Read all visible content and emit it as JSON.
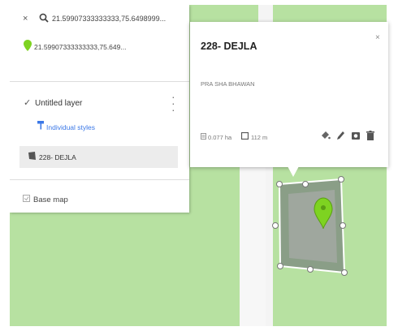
{
  "search": {
    "close": "×",
    "query": "21.59907333333333,75.6498999..."
  },
  "result": {
    "label": "21.59907333333333,75.649..."
  },
  "layer": {
    "title": "Untitled layer",
    "styles_link": "Individual styles",
    "feature_label": "228- DEJLA",
    "basemap_label": "Base map"
  },
  "popup": {
    "title": "228- DEJLA",
    "close": "×",
    "description": "PRA SHA BHAWAN",
    "area": "0.077 ha",
    "length": "112 m"
  },
  "icons": {
    "search": "search-icon",
    "pin": "map-pin-icon",
    "check": "checkbox-icon",
    "menu": "more-vert-icon",
    "styles": "paint-roller-icon",
    "polygon": "polygon-icon",
    "basemap": "basemap-icon",
    "paint": "paint-bucket-icon",
    "edit": "pencil-icon",
    "photo": "camera-icon",
    "delete": "trash-icon"
  },
  "colors": {
    "map_background": "#b7e1a1",
    "polygon_fill": "#8a9e87",
    "pin": "#7ed321",
    "link": "#3b78e7"
  }
}
